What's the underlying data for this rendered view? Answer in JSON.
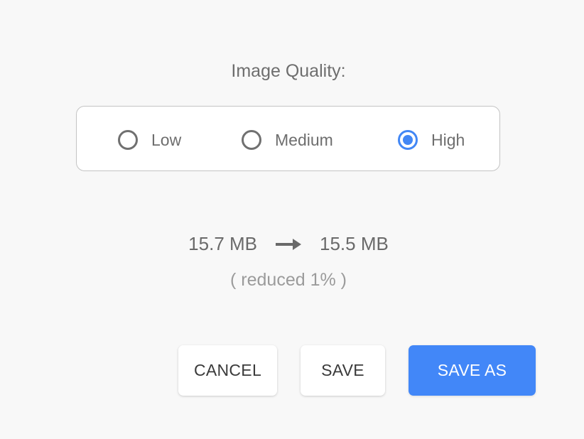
{
  "dialog": {
    "title": "Image Quality:",
    "quality_options": [
      {
        "label": "Low",
        "checked": false
      },
      {
        "label": "Medium",
        "checked": false
      },
      {
        "label": "High",
        "checked": true
      }
    ],
    "selected_quality": "High",
    "original_size": "15.7 MB",
    "arrow_icon": "arrow-right-icon",
    "new_size": "15.5 MB",
    "reduction_text": "( reduced 1% )"
  },
  "buttons": {
    "cancel_label": "CANCEL",
    "save_label": "SAVE",
    "save_as_label": "SAVE AS"
  },
  "colors": {
    "accent": "#4287f5",
    "primary_button": "#4287f8",
    "text": "#6e6e6e",
    "muted_text": "#9b9b9b",
    "background": "#f8f8f8"
  }
}
